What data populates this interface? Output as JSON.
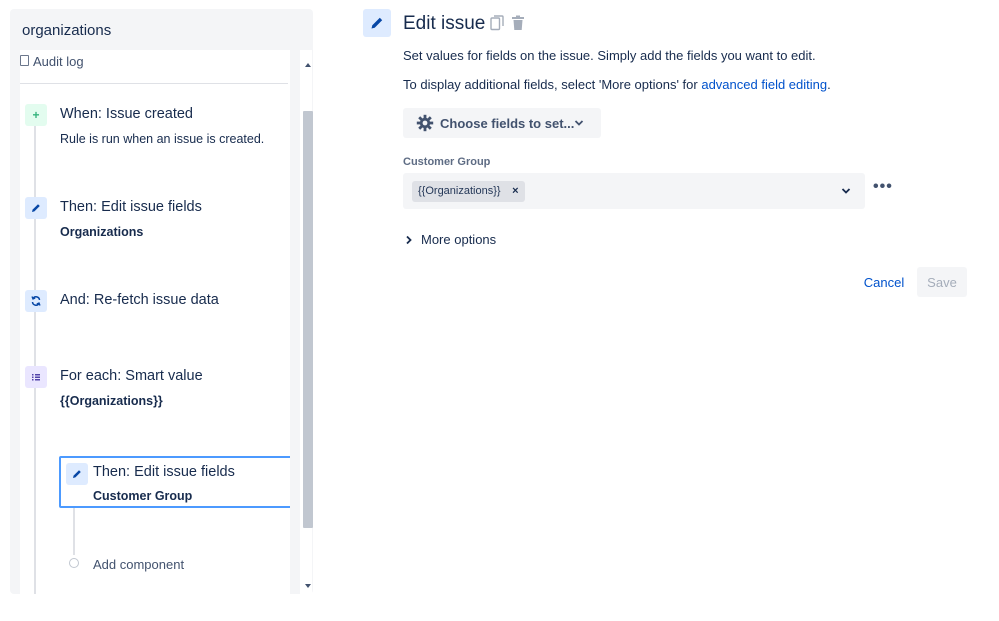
{
  "sidebar": {
    "title": "organizations",
    "audit_label": "Audit log",
    "items": [
      {
        "title": "When: Issue created",
        "subtitle": "Rule is run when an issue is created.",
        "icon": "plus-icon"
      },
      {
        "title": "Then: Edit issue fields",
        "subtitle": "Organizations",
        "icon": "pencil-icon"
      },
      {
        "title": "And: Re-fetch issue data",
        "subtitle": "",
        "icon": "refresh-icon"
      },
      {
        "title": "For each: Smart value",
        "subtitle": "{{Organizations}}",
        "icon": "list-icon"
      },
      {
        "title": "Then: Edit issue fields",
        "subtitle": "Customer Group",
        "icon": "pencil-icon"
      }
    ],
    "add_component": "Add component"
  },
  "main": {
    "title": "Edit issue",
    "description": "Set values for fields on the issue. Simply add the fields you want to edit.",
    "more_fields_prefix": "To display additional fields, select 'More options' for ",
    "more_fields_link": "advanced field editing",
    "more_fields_suffix": ".",
    "choose_fields_label": "Choose fields to set...",
    "field_label": "Customer Group",
    "chip_value": "{{Organizations}}",
    "more_options_label": "More options",
    "cancel_label": "Cancel",
    "save_label": "Save"
  },
  "colors": {
    "accent": "#0052cc",
    "selected_border": "#4c9aff",
    "trigger_green": "#36b37e"
  }
}
